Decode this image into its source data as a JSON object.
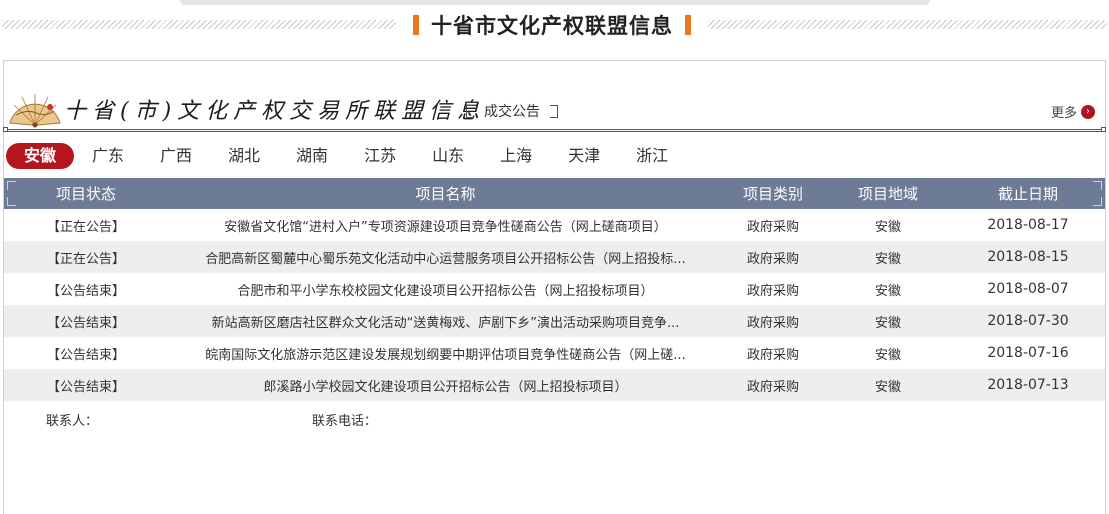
{
  "section_title": "十省市文化产权联盟信息",
  "banner": {
    "calligraphy_title": "十省(市)文化产权交易所联盟信息",
    "deal_label": "成交公告",
    "more_label": "更多"
  },
  "tabs": [
    {
      "label": "安徽",
      "active": true
    },
    {
      "label": "广东",
      "active": false
    },
    {
      "label": "广西",
      "active": false
    },
    {
      "label": "湖北",
      "active": false
    },
    {
      "label": "湖南",
      "active": false
    },
    {
      "label": "江苏",
      "active": false
    },
    {
      "label": "山东",
      "active": false
    },
    {
      "label": "上海",
      "active": false
    },
    {
      "label": "天津",
      "active": false
    },
    {
      "label": "浙江",
      "active": false
    }
  ],
  "table": {
    "headers": [
      "项目状态",
      "项目名称",
      "项目类别",
      "项目地域",
      "截止日期"
    ],
    "rows": [
      {
        "status": "【正在公告】",
        "name": "安徽省文化馆“进村入户”专项资源建设项目竞争性磋商公告（网上磋商项目）",
        "category": "政府采购",
        "region": "安徽",
        "deadline": "2018-08-17"
      },
      {
        "status": "【正在公告】",
        "name": "合肥高新区蜀麓中心蜀乐苑文化活动中心运营服务项目公开招标公告（网上招投标...",
        "category": "政府采购",
        "region": "安徽",
        "deadline": "2018-08-15"
      },
      {
        "status": "【公告结束】",
        "name": "合肥市和平小学东校校园文化建设项目公开招标公告（网上招投标项目）",
        "category": "政府采购",
        "region": "安徽",
        "deadline": "2018-08-07"
      },
      {
        "status": "【公告结束】",
        "name": "新站高新区磨店社区群众文化活动“送黄梅戏、庐剧下乡”演出活动采购项目竞争...",
        "category": "政府采购",
        "region": "安徽",
        "deadline": "2018-07-30"
      },
      {
        "status": "【公告结束】",
        "name": "皖南国际文化旅游示范区建设发展规划纲要中期评估项目竞争性磋商公告（网上磋...",
        "category": "政府采购",
        "region": "安徽",
        "deadline": "2018-07-16"
      },
      {
        "status": "【公告结束】",
        "name": "郎溪路小学校园文化建设项目公开招标公告（网上招投标项目）",
        "category": "政府采购",
        "region": "安徽",
        "deadline": "2018-07-13"
      }
    ]
  },
  "contact": {
    "person_label": "联系人：",
    "phone_label": "联系电话："
  },
  "colors": {
    "accent_red": "#b5161e",
    "header_bg": "#6d7b96",
    "title_bar": "#e8751a"
  },
  "icons": [
    "fan-logo-icon",
    "chevron-right-icon"
  ]
}
